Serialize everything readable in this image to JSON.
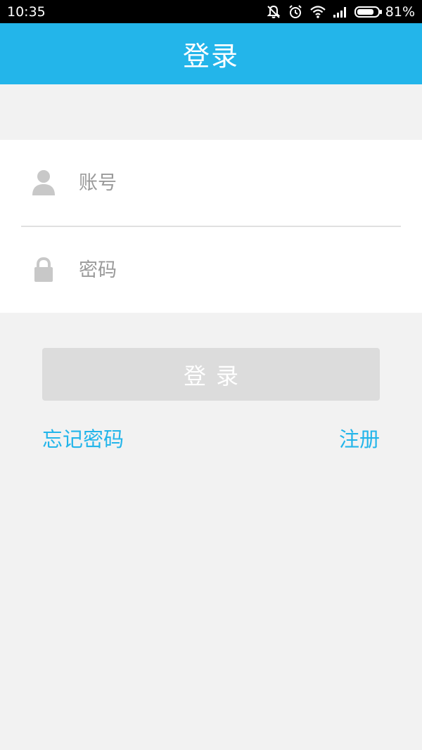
{
  "status_bar": {
    "time": "10:35",
    "battery_percent": "81%",
    "battery_level": 0.81,
    "icons": [
      "muted-bell-icon",
      "alarm-icon",
      "wifi-icon",
      "signal-icon",
      "battery-icon"
    ]
  },
  "header": {
    "title": "登录"
  },
  "form": {
    "account_placeholder": "账号",
    "account_icon": "user-icon",
    "password_placeholder": "密码",
    "password_icon": "lock-icon"
  },
  "actions": {
    "login_label": "登录",
    "forgot_password_label": "忘记密码",
    "register_label": "注册"
  },
  "colors": {
    "accent": "#23b5ea",
    "background": "#f2f2f2",
    "button_disabled": "#dcdcdc",
    "icon_gray": "#c8c8c8"
  }
}
